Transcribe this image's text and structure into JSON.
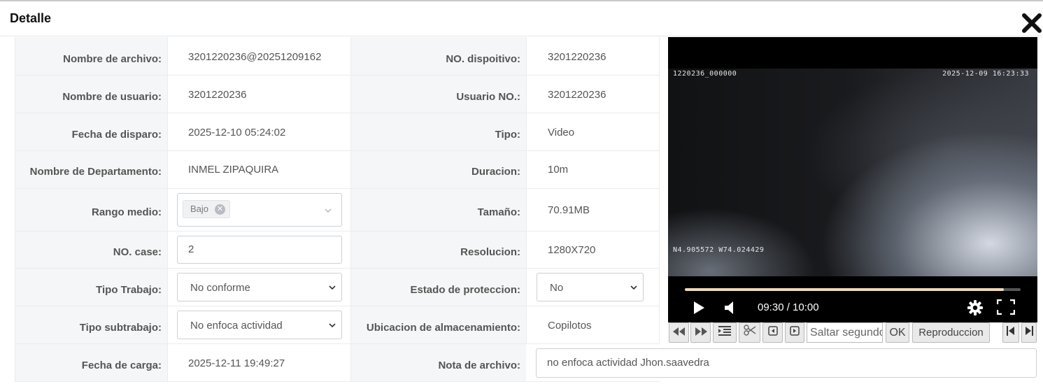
{
  "dialog": {
    "title": "Detalle",
    "close_icon": "close-icon"
  },
  "fields": {
    "file_name": {
      "label": "Nombre de archivo:",
      "value": "3201220236@20251209162"
    },
    "device_no": {
      "label": "NO. dispoitivo:",
      "value": "3201220236"
    },
    "user_name": {
      "label": "Nombre de usuario:",
      "value": "3201220236"
    },
    "user_no": {
      "label": "Usuario NO.:",
      "value": "3201220236"
    },
    "trigger_date": {
      "label": "Fecha de disparo:",
      "value": "2025-12-10 05:24:02"
    },
    "type": {
      "label": "Tipo:",
      "value": "Video"
    },
    "department": {
      "label": "Nombre de Departamento:",
      "value": "INMEL ZIPAQUIRA"
    },
    "duration": {
      "label": "Duracion:",
      "value": "10m"
    },
    "range": {
      "label": "Rango medio:",
      "tag": "Bajo"
    },
    "size": {
      "label": "Tamaño:",
      "value": "70.91MB"
    },
    "case_no": {
      "label": "NO. case:",
      "value": "2"
    },
    "resolution": {
      "label": "Resolucion:",
      "value": "1280X720"
    },
    "work_type": {
      "label": "Tipo Trabajo:",
      "value": "No conforme"
    },
    "protection": {
      "label": "Estado de proteccion:",
      "value": "No"
    },
    "subwork_type": {
      "label": "Tipo subtrabajo:",
      "value": "No enfoca actividad"
    },
    "storage": {
      "label": "Ubicacion de almacenamiento:",
      "value": "Copilotos"
    },
    "upload_date": {
      "label": "Fecha de carga:",
      "value": "2025-12-11 19:49:27"
    },
    "file_note": {
      "label": "Nota de archivo:",
      "value": "no enfoca actividad Jhon.saavedra"
    }
  },
  "player": {
    "osd_top_left": "1220236_000000",
    "osd_top_right": "2025-12-09 16:23:33",
    "osd_bottom_left": "N4.905572 W74.024429",
    "time": "09:30 / 10:00",
    "progress_fraction": 0.95,
    "accent_color": "#f0d9b5"
  },
  "toolbar": {
    "seek_placeholder": "Saltar segundo",
    "ok_label": "OK",
    "playback_label": "Reproduccion"
  }
}
